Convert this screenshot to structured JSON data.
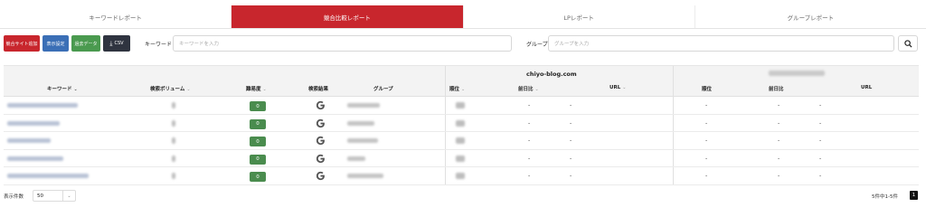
{
  "tabs": [
    {
      "label": "キーワードレポート"
    },
    {
      "label": "競合比較レポート"
    },
    {
      "label": "LPレポート"
    },
    {
      "label": "グループレポート"
    }
  ],
  "toolbar": {
    "add_site_label": "競合サイト追加",
    "display_settings_label": "表示設定",
    "past_data_label": "過去データ",
    "csv_label": "CSV",
    "accent": "#c8262d"
  },
  "filters": {
    "keyword_label": "キーワード",
    "keyword_placeholder": "キーワードを入力",
    "group_label": "グループ",
    "group_placeholder": "グループを入力"
  },
  "table": {
    "site_name": "chiyo-blog.com",
    "headers": {
      "keyword": "キーワード",
      "volume": "検索ボリューム",
      "difficulty": "難易度",
      "results": "検索結果",
      "group": "グループ",
      "rank": "順位",
      "change": "前日比",
      "url": "URL",
      "rank2": "順位",
      "change2": "前日比",
      "url2": "URL"
    },
    "rows": [
      {
        "difficulty": "0",
        "d1": "-",
        "d2": "-",
        "d3": "-",
        "d4": "-",
        "d5": "-"
      },
      {
        "difficulty": "0",
        "d1": "-",
        "d2": "-",
        "d3": "-",
        "d4": "-",
        "d5": "-"
      },
      {
        "difficulty": "0",
        "d1": "-",
        "d2": "-",
        "d3": "-",
        "d4": "-",
        "d5": "-"
      },
      {
        "difficulty": "0",
        "d1": "-",
        "d2": "-",
        "d3": "-",
        "d4": "-",
        "d5": "-"
      },
      {
        "difficulty": "0",
        "d1": "-",
        "d2": "-",
        "d3": "-",
        "d4": "-",
        "d5": "-"
      }
    ]
  },
  "footer": {
    "rows_label": "表示件数",
    "page_size": "50",
    "page_info": "5件中1-5件",
    "current_page": "1"
  }
}
